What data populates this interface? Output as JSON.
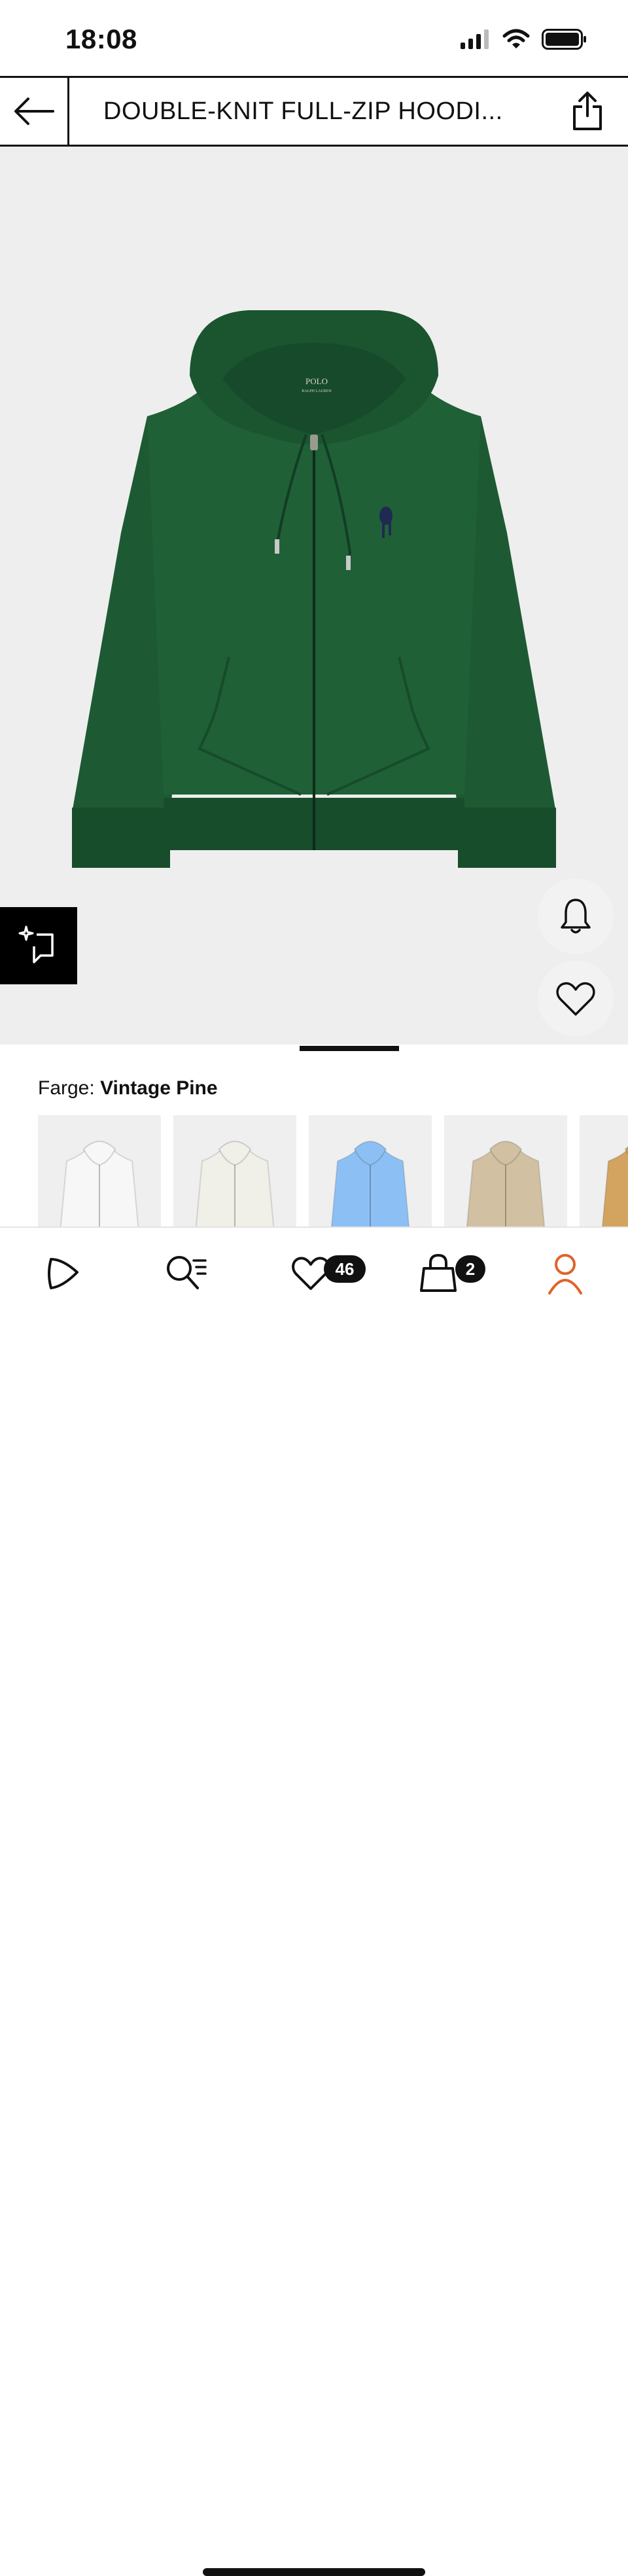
{
  "status_bar": {
    "time": "18:08"
  },
  "header": {
    "title": "DOUBLE-KNIT FULL-ZIP HOODI..."
  },
  "product": {
    "brand_label_line1": "POLO",
    "brand_label_line2": "RALPH LAUREN",
    "color_prefix": "Farge:",
    "color_name": "Vintage Pine",
    "main_color": "#1d5a33",
    "swatches": [
      {
        "name": "white",
        "color": "#f7f7f7"
      },
      {
        "name": "cream",
        "color": "#f0efe8"
      },
      {
        "name": "light-blue",
        "color": "#8cc0f5"
      },
      {
        "name": "tan",
        "color": "#d2c0a3"
      },
      {
        "name": "mustard",
        "color": "#d2a45f"
      }
    ]
  },
  "tab_bar": {
    "wishlist_count": "46",
    "cart_count": "2",
    "active_color": "#e0622a"
  }
}
